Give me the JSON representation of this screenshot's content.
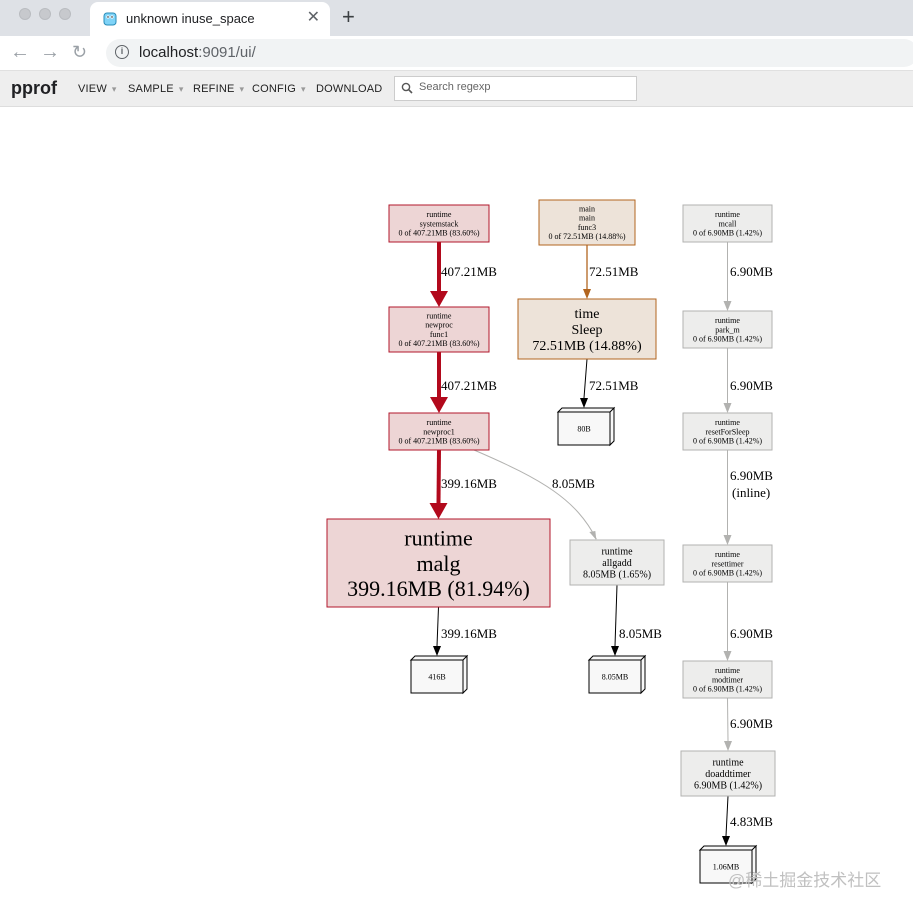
{
  "browser": {
    "tab_title": "unknown inuse_space",
    "url_host": "localhost",
    "url_path": ":9091/ui/",
    "new_tab_label": "+",
    "close_label": "✕"
  },
  "app": {
    "logo": "pprof",
    "menu": [
      "VIEW",
      "SAMPLE",
      "REFINE",
      "CONFIG",
      "DOWNLOAD"
    ],
    "search_placeholder": "Search regexp"
  },
  "graph": {
    "nodes": [
      {
        "id": "systemstack",
        "lines": [
          "runtime",
          "systemstack",
          "0 of 407.21MB (83.60%)"
        ],
        "fill": "#edd5d5",
        "stroke": "#b2172b"
      },
      {
        "id": "newproc",
        "lines": [
          "runtime",
          "newproc",
          "func1",
          "0 of 407.21MB (83.60%)"
        ],
        "fill": "#edd5d5",
        "stroke": "#b2172b"
      },
      {
        "id": "newproc1",
        "lines": [
          "runtime",
          "newproc1",
          "0 of 407.21MB (83.60%)"
        ],
        "fill": "#edd5d5",
        "stroke": "#b2172b"
      },
      {
        "id": "malg",
        "lines": [
          "runtime",
          "malg",
          "399.16MB (81.94%)"
        ],
        "fill": "#edd5d5",
        "stroke": "#b2172b"
      },
      {
        "id": "mainfunc3",
        "lines": [
          "main",
          "main",
          "func3",
          "0 of 72.51MB (14.88%)"
        ],
        "fill": "#ede3d9",
        "stroke": "#b2651f"
      },
      {
        "id": "sleep",
        "lines": [
          "time",
          "Sleep",
          "72.51MB (14.88%)"
        ],
        "fill": "#ede3d9",
        "stroke": "#b2651f"
      },
      {
        "id": "allgadd",
        "lines": [
          "runtime",
          "allgadd",
          "8.05MB (1.65%)"
        ],
        "fill": "#ededec",
        "stroke": "#b2b2b0"
      },
      {
        "id": "mcall",
        "lines": [
          "runtime",
          "mcall",
          "0 of 6.90MB (1.42%)"
        ],
        "fill": "#ededec",
        "stroke": "#b2b2b0"
      },
      {
        "id": "park_m",
        "lines": [
          "runtime",
          "park_m",
          "0 of 6.90MB (1.42%)"
        ],
        "fill": "#ededec",
        "stroke": "#b2b2b0"
      },
      {
        "id": "resetForSleep",
        "lines": [
          "runtime",
          "resetForSleep",
          "0 of 6.90MB (1.42%)"
        ],
        "fill": "#ededec",
        "stroke": "#b2b2b0"
      },
      {
        "id": "resettimer",
        "lines": [
          "runtime",
          "resettimer",
          "0 of 6.90MB (1.42%)"
        ],
        "fill": "#ededec",
        "stroke": "#b2b2b0"
      },
      {
        "id": "modtimer",
        "lines": [
          "runtime",
          "modtimer",
          "0 of 6.90MB (1.42%)"
        ],
        "fill": "#ededec",
        "stroke": "#b2b2b0"
      },
      {
        "id": "doaddtimer",
        "lines": [
          "runtime",
          "doaddtimer",
          "6.90MB (1.42%)"
        ],
        "fill": "#ededec",
        "stroke": "#b2b2b0"
      }
    ],
    "leaves": [
      {
        "id": "leaf-80B",
        "label": "80B"
      },
      {
        "id": "leaf-416B",
        "label": "416B"
      },
      {
        "id": "leaf-8.05MB",
        "label": "8.05MB"
      },
      {
        "id": "leaf-1.06MB",
        "label": "1.06MB"
      }
    ],
    "edges": [
      {
        "from": "systemstack",
        "to": "newproc",
        "label": "407.21MB",
        "color": "#b2091c"
      },
      {
        "from": "newproc",
        "to": "newproc1",
        "label": "407.21MB",
        "color": "#b2091c"
      },
      {
        "from": "newproc1",
        "to": "malg",
        "label": "399.16MB",
        "color": "#b2091c"
      },
      {
        "from": "newproc1",
        "to": "allgadd",
        "label": "8.05MB",
        "color": "#b2b2b0"
      },
      {
        "from": "malg",
        "to": "leaf-416B",
        "label": "399.16MB",
        "color": "#000000"
      },
      {
        "from": "allgadd",
        "to": "leaf-8.05MB",
        "label": "8.05MB",
        "color": "#000000"
      },
      {
        "from": "mainfunc3",
        "to": "sleep",
        "label": "72.51MB",
        "color": "#b2651f"
      },
      {
        "from": "sleep",
        "to": "leaf-80B",
        "label": "72.51MB",
        "color": "#000000"
      },
      {
        "from": "mcall",
        "to": "park_m",
        "label": "6.90MB",
        "color": "#b2b2b0"
      },
      {
        "from": "park_m",
        "to": "resetForSleep",
        "label": "6.90MB",
        "color": "#b2b2b0"
      },
      {
        "from": "resetForSleep",
        "to": "resettimer",
        "label": "6.90MB",
        "label2": "(inline)",
        "color": "#b2b2b0"
      },
      {
        "from": "resettimer",
        "to": "modtimer",
        "label": "6.90MB",
        "color": "#b2b2b0"
      },
      {
        "from": "modtimer",
        "to": "doaddtimer",
        "label": "6.90MB",
        "color": "#b2b2b0"
      },
      {
        "from": "doaddtimer",
        "to": "leaf-1.06MB",
        "label": "4.83MB",
        "color": "#000000"
      }
    ]
  },
  "watermark": "@稀土掘金技术社区"
}
